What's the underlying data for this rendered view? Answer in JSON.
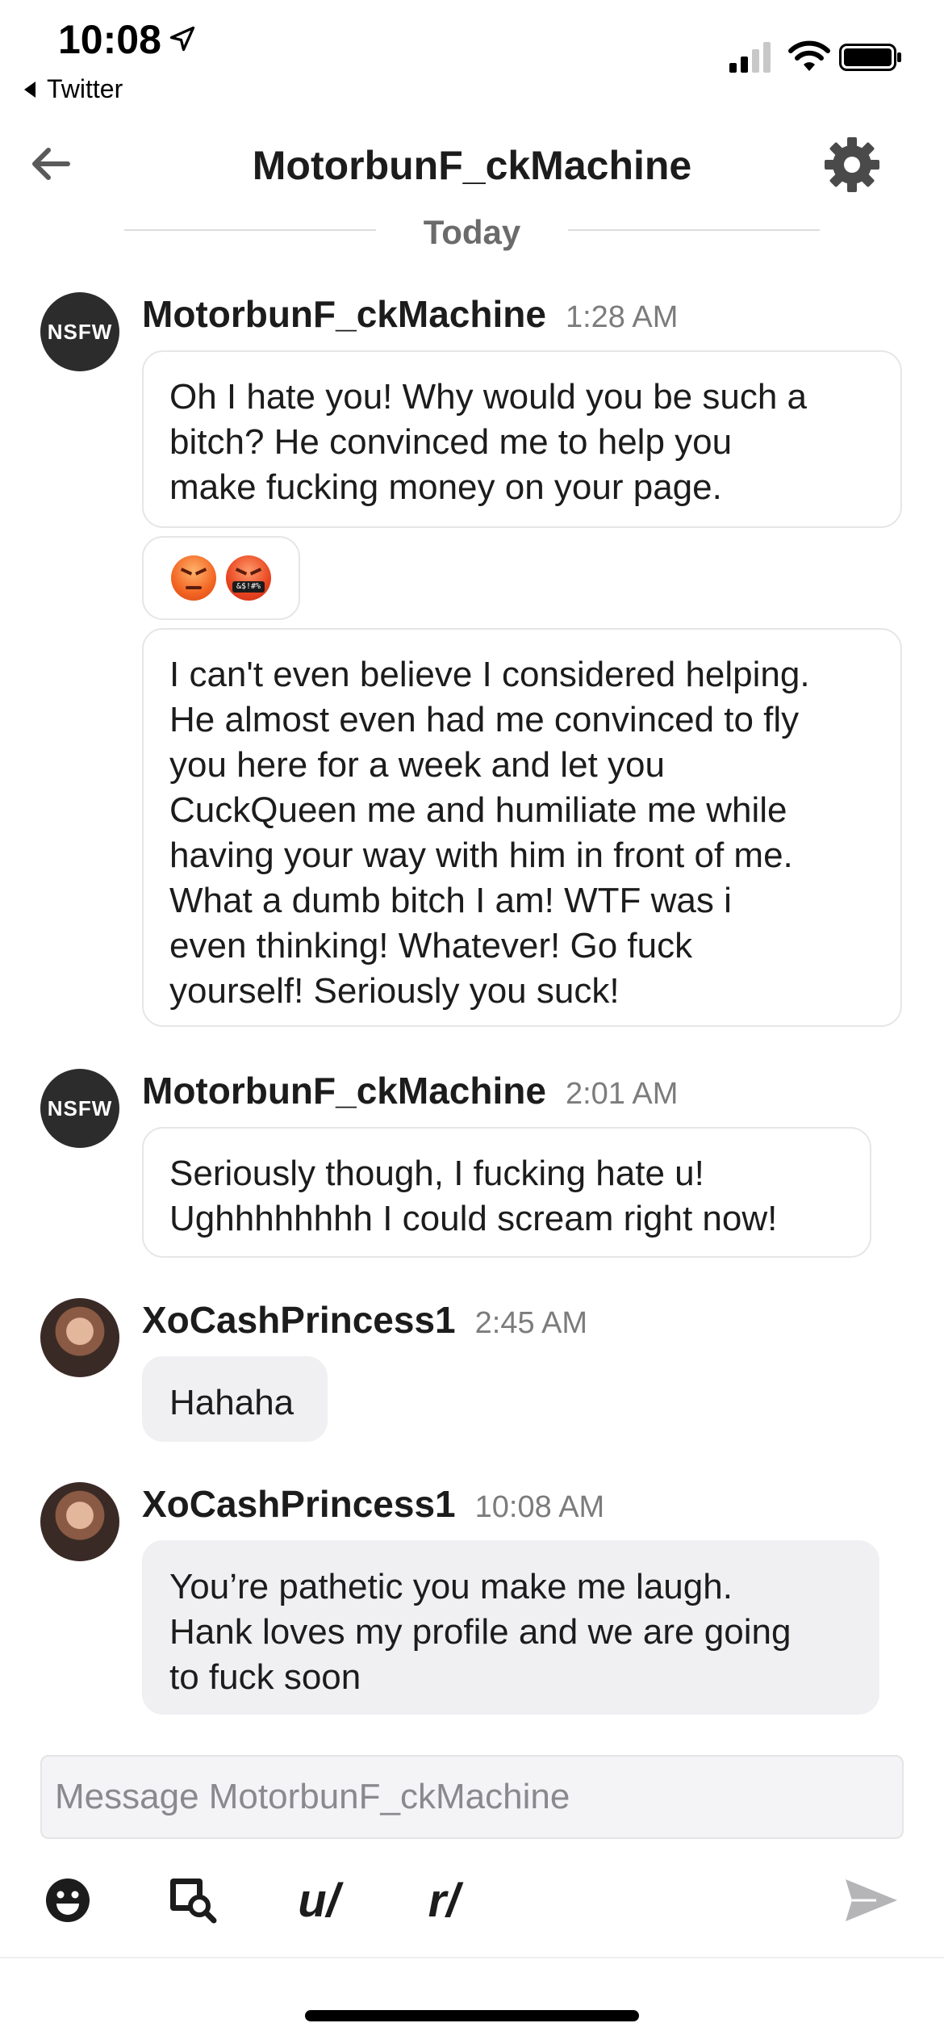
{
  "status_bar": {
    "time": "10:08",
    "back_app": "Twitter"
  },
  "header": {
    "title": "MotorbunF_ckMachine",
    "back_icon": "back-arrow-icon",
    "settings_icon": "gear-icon"
  },
  "divider": {
    "label": "Today"
  },
  "messages": [
    {
      "author": "MotorbunF_ckMachine",
      "avatar_text": "NSFW",
      "time": "1:28 AM",
      "bubbles": [
        "Oh I hate you!  Why would you be such a\nbitch? He convinced me to help you\nmake fucking money on your page.",
        "I can't even believe I considered helping.\nHe almost even had me convinced to fly\nyou here for a week and let you\nCuckQueen me and humiliate me while\nhaving your way with him in front of me.\nWhat a dumb bitch I am!  WTF was i\neven thinking!  Whatever!  Go fuck\nyourself!  Seriously you suck!"
      ],
      "emoji_bar_text": "&$!#%"
    },
    {
      "author": "MotorbunF_ckMachine",
      "avatar_text": "NSFW",
      "time": "2:01 AM",
      "bubbles": [
        "Seriously though,  I fucking hate u!\nUghhhhhhhh  I could scream right now!"
      ]
    },
    {
      "author": "XoCashPrincess1",
      "time": "2:45 AM",
      "bubbles": [
        "Hahaha"
      ]
    },
    {
      "author": "XoCashPrincess1",
      "time": "10:08 AM",
      "bubbles": [
        "You’re pathetic you make me laugh.\nHank loves my profile and we are going\nto fuck soon"
      ]
    }
  ],
  "composer": {
    "placeholder": "Message MotorbunF_ckMachine"
  },
  "toolbar": {
    "user_label": "u/",
    "subreddit_label": "r/"
  },
  "colors": {
    "text": "#1c1c1c",
    "timestamp": "#7c7c7c",
    "grey_bubble": "#f0f0f2",
    "send_icon": "#b5b5b8"
  }
}
